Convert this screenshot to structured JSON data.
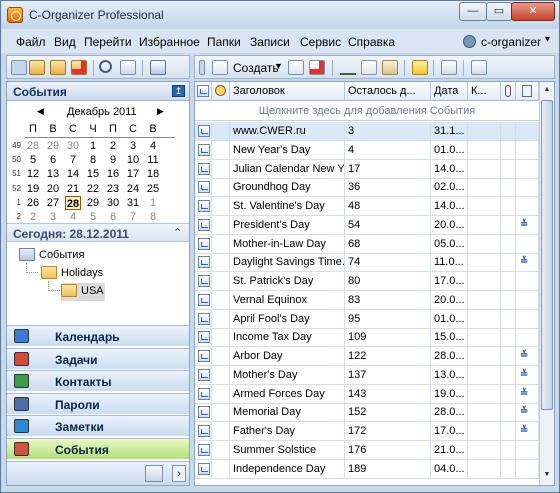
{
  "window": {
    "title": "C-Organizer Professional",
    "minimize": "—",
    "maximize": "▭",
    "close": "✕"
  },
  "menu": [
    "Файл",
    "Вид",
    "Перейти",
    "Избранное",
    "Папки",
    "Записи",
    "Сервис",
    "Справка"
  ],
  "user": {
    "name": "c-organizer",
    "arrow": "▾"
  },
  "toolbar": {
    "create_label": "Создать",
    "create_arrow": "▼"
  },
  "panel": {
    "title": "События",
    "pin": "↥"
  },
  "calendar": {
    "month": "Декабрь 2011",
    "prev": "◀",
    "next": "▶",
    "weekdays": [
      "П",
      "В",
      "С",
      "Ч",
      "П",
      "С",
      "В"
    ],
    "weeks": [
      {
        "num": "49",
        "days": [
          "28",
          "29",
          "30",
          "1",
          "2",
          "3",
          "4"
        ],
        "gray": [
          true,
          true,
          true,
          false,
          false,
          false,
          false
        ]
      },
      {
        "num": "50",
        "days": [
          "5",
          "6",
          "7",
          "8",
          "9",
          "10",
          "11"
        ],
        "gray": [
          false,
          false,
          false,
          false,
          false,
          false,
          false
        ]
      },
      {
        "num": "51",
        "days": [
          "12",
          "13",
          "14",
          "15",
          "16",
          "17",
          "18"
        ],
        "gray": [
          false,
          false,
          false,
          false,
          false,
          false,
          false
        ]
      },
      {
        "num": "52",
        "days": [
          "19",
          "20",
          "21",
          "22",
          "23",
          "24",
          "25"
        ],
        "gray": [
          false,
          false,
          false,
          false,
          false,
          false,
          false
        ]
      },
      {
        "num": "1",
        "days": [
          "26",
          "27",
          "28",
          "29",
          "30",
          "31",
          "1"
        ],
        "gray": [
          false,
          false,
          false,
          false,
          false,
          false,
          true
        ]
      },
      {
        "num": "2",
        "days": [
          "2",
          "3",
          "4",
          "5",
          "6",
          "7",
          "8"
        ],
        "gray": [
          true,
          true,
          true,
          true,
          true,
          true,
          true
        ]
      }
    ],
    "today_index": {
      "week": 4,
      "day": 2
    }
  },
  "today": {
    "text": "Сегодня: 28.12.2011",
    "chevron": "⌃"
  },
  "tree": {
    "root": "События",
    "holidays": "Holidays",
    "usa": "USA"
  },
  "nav": [
    {
      "label": "Календарь",
      "color": "#3a7bd5",
      "active": false
    },
    {
      "label": "Задачи",
      "color": "#d24b3a",
      "active": false
    },
    {
      "label": "Контакты",
      "color": "#3f9a4a",
      "active": false
    },
    {
      "label": "Пароли",
      "color": "#4a6fa8",
      "active": false
    },
    {
      "label": "Заметки",
      "color": "#2b8ad4",
      "active": false
    },
    {
      "label": "События",
      "color": "#d0553c",
      "active": true
    }
  ],
  "nav_footer": {
    "arrow": "›"
  },
  "grid": {
    "headers": [
      "",
      "",
      "Заголовок",
      "Осталось д...",
      "Дата",
      "К...",
      "",
      ""
    ],
    "hint": "Щелкните здесь для добавления События",
    "rows": [
      {
        "title": "www.CWER.ru",
        "days": "3",
        "date": "31.1...",
        "recurring": false,
        "selected": true
      },
      {
        "title": "New Year's Day",
        "days": "4",
        "date": "01.0...",
        "recurring": false
      },
      {
        "title": "Julian Calendar New Y...",
        "days": "17",
        "date": "14.0...",
        "recurring": false
      },
      {
        "title": "Groundhog Day",
        "days": "36",
        "date": "02.0...",
        "recurring": false
      },
      {
        "title": "St. Valentine's Day",
        "days": "48",
        "date": "14.0...",
        "recurring": false
      },
      {
        "title": "President's Day",
        "days": "54",
        "date": "20.0...",
        "recurring": true
      },
      {
        "title": "Mother-in-Law Day",
        "days": "68",
        "date": "05.0...",
        "recurring": false
      },
      {
        "title": "Daylight Savings Time...",
        "days": "74",
        "date": "11.0...",
        "recurring": true
      },
      {
        "title": "St. Patrick's Day",
        "days": "80",
        "date": "17.0...",
        "recurring": false
      },
      {
        "title": "Vernal Equinox",
        "days": "83",
        "date": "20.0...",
        "recurring": false
      },
      {
        "title": "April Fool's Day",
        "days": "95",
        "date": "01.0...",
        "recurring": false
      },
      {
        "title": "Income Tax Day",
        "days": "109",
        "date": "15.0...",
        "recurring": false
      },
      {
        "title": "Arbor Day",
        "days": "122",
        "date": "28.0...",
        "recurring": true
      },
      {
        "title": "Mother's Day",
        "days": "137",
        "date": "13.0...",
        "recurring": true
      },
      {
        "title": "Armed Forces Day",
        "days": "143",
        "date": "19.0...",
        "recurring": true
      },
      {
        "title": "Memorial Day",
        "days": "152",
        "date": "28.0...",
        "recurring": true
      },
      {
        "title": "Father's Day",
        "days": "172",
        "date": "17.0...",
        "recurring": true
      },
      {
        "title": "Summer Solstice",
        "days": "176",
        "date": "21.0...",
        "recurring": false
      },
      {
        "title": "Independence Day",
        "days": "189",
        "date": "04.0...",
        "recurring": false
      }
    ],
    "recurring_icon": "≚"
  },
  "scroll": {
    "up": "▲",
    "down": "▼"
  }
}
